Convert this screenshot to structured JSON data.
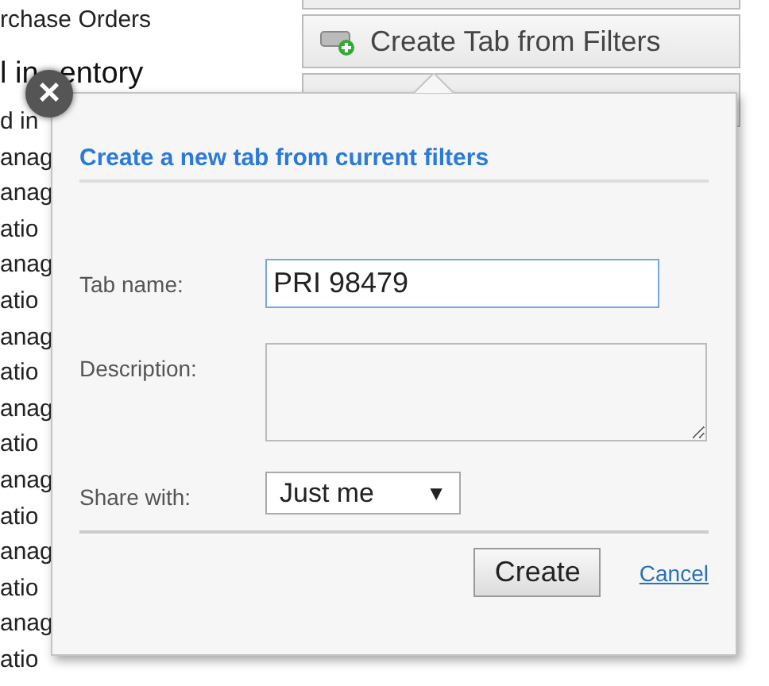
{
  "background": {
    "list_lines": [
      {
        "kind": "item",
        "text": "rchase Orders"
      },
      {
        "kind": "heading",
        "parts": [
          "l in",
          "entory"
        ]
      },
      {
        "kind": "item",
        "text": "d in"
      },
      {
        "kind": "item",
        "text": "anag"
      },
      {
        "kind": "item",
        "text": "anag"
      },
      {
        "kind": "item",
        "text": "atio"
      },
      {
        "kind": "item",
        "text": "anag"
      },
      {
        "kind": "item",
        "text": "atio"
      },
      {
        "kind": "item",
        "text": "anag"
      },
      {
        "kind": "item",
        "text": "atio"
      },
      {
        "kind": "item",
        "text": "anag"
      },
      {
        "kind": "item",
        "text": "atio"
      },
      {
        "kind": "item",
        "text": "anag"
      },
      {
        "kind": "item",
        "text": "atio"
      },
      {
        "kind": "item",
        "text": "anag"
      },
      {
        "kind": "item",
        "text": "atio"
      },
      {
        "kind": "item",
        "text": "anag"
      },
      {
        "kind": "item",
        "text": "atio"
      }
    ],
    "action_buttons": [
      {
        "label": "Create Tab from Filters"
      }
    ]
  },
  "dialog": {
    "title": "Create a new tab from current filters",
    "fields": [
      {
        "kind": "text",
        "label": "Tab name:",
        "value": "PRI 98479"
      },
      {
        "kind": "textarea",
        "label": "Description:"
      },
      {
        "kind": "select",
        "label": "Share with:",
        "value": "Just me",
        "arrow": "▼"
      }
    ],
    "buttons": [
      {
        "kind": "button",
        "label": "Create"
      },
      {
        "kind": "link",
        "label": "Cancel"
      }
    ],
    "close": "×"
  }
}
